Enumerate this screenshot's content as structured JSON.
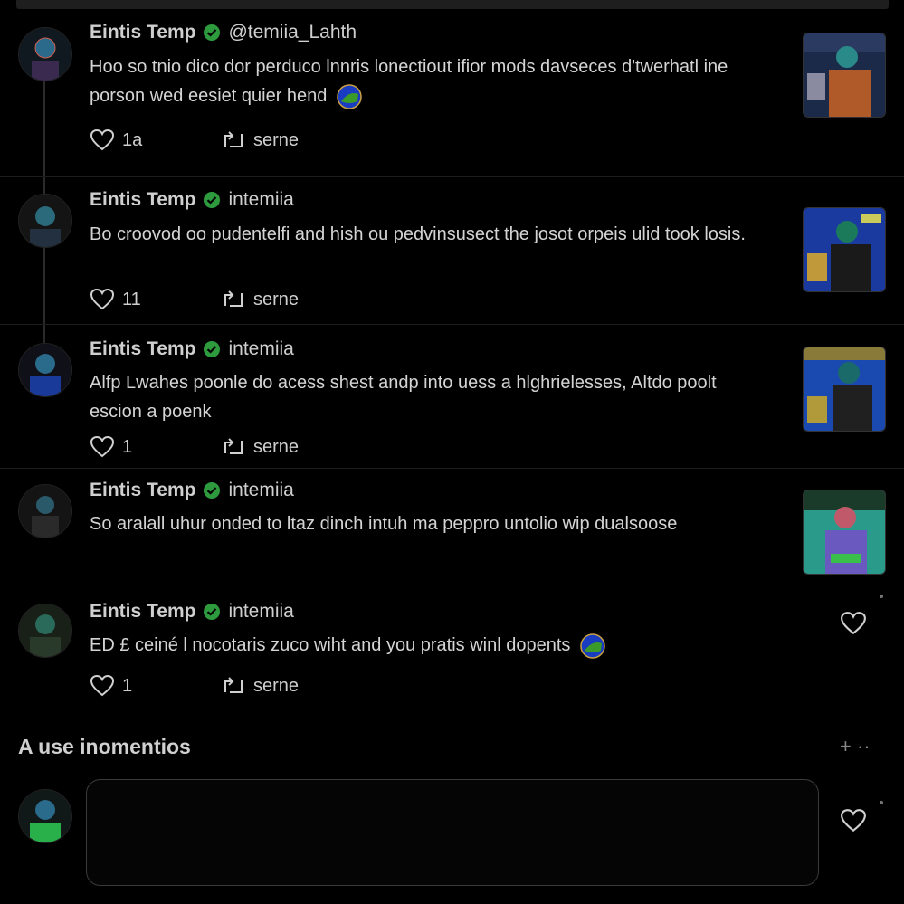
{
  "posts": [
    {
      "author": "Eintis Temp",
      "handle": "@temiia_Lahth",
      "text": "Hoo so tnio dico dor perduco lnnris lonectiout ifior mods davseces d'twerhatl ine porson wed eesiet quier hend",
      "like_count": "1a",
      "share_label": "serne",
      "has_globe": true
    },
    {
      "author": "Eintis Temp",
      "handle": "intemiia",
      "text": "Bo croovod oo pudentelfi and hish ou pedvinsusect the josot orpeis ulid took losis.",
      "like_count": "11",
      "share_label": "serne",
      "has_globe": false
    },
    {
      "author": "Eintis Temp",
      "handle": "intemiia",
      "text": "Alfp Lwahes poonle do acess shest andp into uess a hlghrielesses, Altdo poolt escion a poenk",
      "like_count": "1",
      "share_label": "serne",
      "has_globe": false
    },
    {
      "author": "Eintis Temp",
      "handle": "intemiia",
      "text": "So aralall uhur onded to ltaz dinch intuh ma peppro untolio wip dualsoose",
      "like_count": "",
      "share_label": "",
      "has_globe": false
    },
    {
      "author": "Eintis Temp",
      "handle": "intemiia",
      "text": "ED £ ceiné l nocotaris zuco wiht and you pratis winl dopents",
      "like_count": "1",
      "share_label": "serne",
      "has_globe": true
    }
  ],
  "section": {
    "title": "A use inomentios",
    "actions": "+ ··"
  },
  "composer": {
    "placeholder": ""
  },
  "icons": {
    "verified": "verified-badge-icon",
    "like": "heart-icon",
    "share": "repost-icon",
    "globe": "globe-icon"
  },
  "colors": {
    "background": "#000000",
    "verified": "#2e9a3e",
    "text": "#d4d4d4"
  }
}
